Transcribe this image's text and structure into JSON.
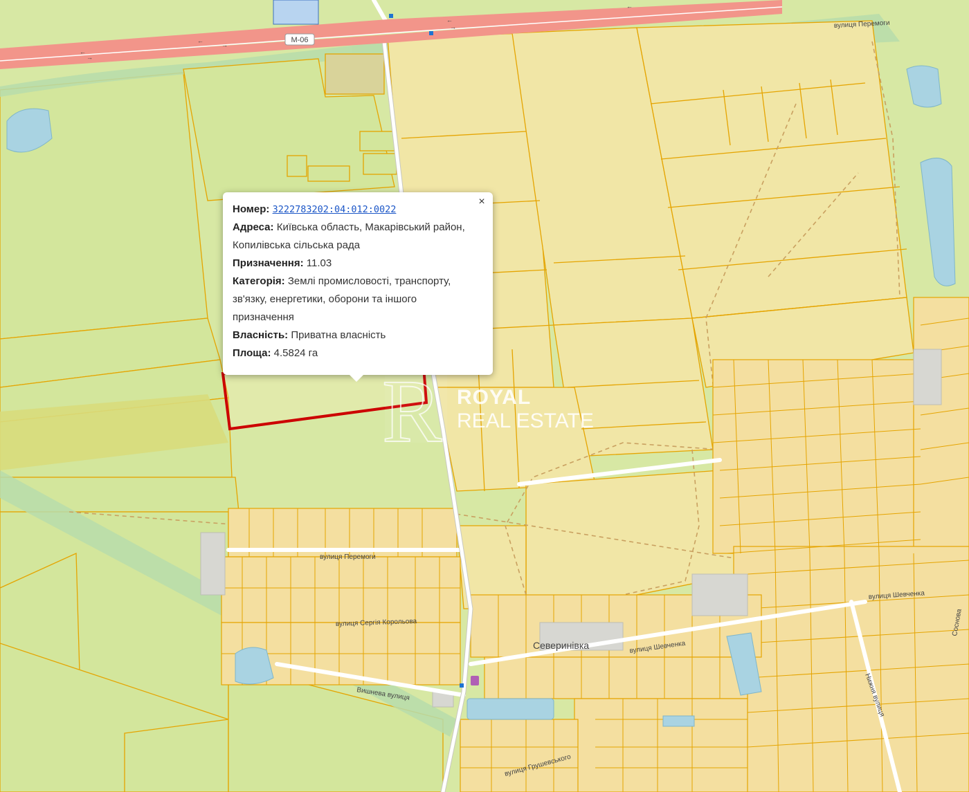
{
  "map": {
    "road_label": "М-06",
    "streets": {
      "peremohy_top": "вулиця Перемоги",
      "peremohy_mid": "вулиця Перемоги",
      "shevchenka_right": "вулиця Шевченка",
      "shevchenka_mid": "вулиця Шевченка",
      "serhiya_koroleva": "вулиця Сергія Корольова",
      "vyshneva": "Вишнева вулиця",
      "hrushevskoho": "вулиця Грушевського",
      "nyzhnia": "Нижня вулиця",
      "sosnova": "Соснова"
    },
    "village": "Северинівка",
    "colors": {
      "road": "#f2958a",
      "parcel_border": "#e5a400",
      "agri_land": "#d5e7a0",
      "field_land": "#f1e6a4",
      "residential": "#f5e0a0",
      "water": "#a9d3e2",
      "selected_parcel": "#cc0000"
    }
  },
  "popup": {
    "number_label": "Номер:",
    "number_value": "3222783202:04:012:0022",
    "address_label": "Адреса:",
    "address_value": "Київська область, Макарівський район, Копилівська сільська рада",
    "purpose_label": "Призначення:",
    "purpose_value": "11.03",
    "category_label": "Категорія:",
    "category_value": "Землі промисловості, транспорту, зв'язку, енергетики, оборони та іншого призначення",
    "ownership_label": "Власність:",
    "ownership_value": "Приватна власність",
    "area_label": "Площа:",
    "area_value": "4.5824 га",
    "close_icon": "×"
  },
  "watermark": {
    "line1": "ROYAL",
    "line2": "REAL ESTATE",
    "logo_letter": "R"
  }
}
